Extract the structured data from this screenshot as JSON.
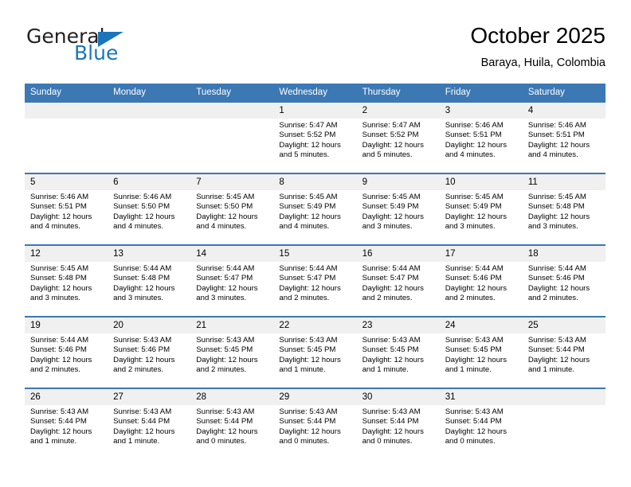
{
  "brand": {
    "name_top": "General",
    "name_bottom": "Blue",
    "accent_color": "#1b75bb",
    "text_color": "#231f20"
  },
  "header": {
    "title": "October 2025",
    "subtitle": "Baraya, Huila, Colombia"
  },
  "theme": {
    "header_row_bg": "#3b78b4",
    "header_row_text": "#ffffff",
    "daynum_bg": "#f0f0f0",
    "cell_bg": "#ffffff",
    "row_divider": "#3b78b4"
  },
  "calendar": {
    "weekday_headers": [
      "Sunday",
      "Monday",
      "Tuesday",
      "Wednesday",
      "Thursday",
      "Friday",
      "Saturday"
    ],
    "weeks": [
      [
        {
          "day": "",
          "empty": true
        },
        {
          "day": "",
          "empty": true
        },
        {
          "day": "",
          "empty": true
        },
        {
          "day": "1",
          "sunrise": "Sunrise: 5:47 AM",
          "sunset": "Sunset: 5:52 PM",
          "daylight": "Daylight: 12 hours and 5 minutes."
        },
        {
          "day": "2",
          "sunrise": "Sunrise: 5:47 AM",
          "sunset": "Sunset: 5:52 PM",
          "daylight": "Daylight: 12 hours and 5 minutes."
        },
        {
          "day": "3",
          "sunrise": "Sunrise: 5:46 AM",
          "sunset": "Sunset: 5:51 PM",
          "daylight": "Daylight: 12 hours and 4 minutes."
        },
        {
          "day": "4",
          "sunrise": "Sunrise: 5:46 AM",
          "sunset": "Sunset: 5:51 PM",
          "daylight": "Daylight: 12 hours and 4 minutes."
        }
      ],
      [
        {
          "day": "5",
          "sunrise": "Sunrise: 5:46 AM",
          "sunset": "Sunset: 5:51 PM",
          "daylight": "Daylight: 12 hours and 4 minutes."
        },
        {
          "day": "6",
          "sunrise": "Sunrise: 5:46 AM",
          "sunset": "Sunset: 5:50 PM",
          "daylight": "Daylight: 12 hours and 4 minutes."
        },
        {
          "day": "7",
          "sunrise": "Sunrise: 5:45 AM",
          "sunset": "Sunset: 5:50 PM",
          "daylight": "Daylight: 12 hours and 4 minutes."
        },
        {
          "day": "8",
          "sunrise": "Sunrise: 5:45 AM",
          "sunset": "Sunset: 5:49 PM",
          "daylight": "Daylight: 12 hours and 4 minutes."
        },
        {
          "day": "9",
          "sunrise": "Sunrise: 5:45 AM",
          "sunset": "Sunset: 5:49 PM",
          "daylight": "Daylight: 12 hours and 3 minutes."
        },
        {
          "day": "10",
          "sunrise": "Sunrise: 5:45 AM",
          "sunset": "Sunset: 5:49 PM",
          "daylight": "Daylight: 12 hours and 3 minutes."
        },
        {
          "day": "11",
          "sunrise": "Sunrise: 5:45 AM",
          "sunset": "Sunset: 5:48 PM",
          "daylight": "Daylight: 12 hours and 3 minutes."
        }
      ],
      [
        {
          "day": "12",
          "sunrise": "Sunrise: 5:45 AM",
          "sunset": "Sunset: 5:48 PM",
          "daylight": "Daylight: 12 hours and 3 minutes."
        },
        {
          "day": "13",
          "sunrise": "Sunrise: 5:44 AM",
          "sunset": "Sunset: 5:48 PM",
          "daylight": "Daylight: 12 hours and 3 minutes."
        },
        {
          "day": "14",
          "sunrise": "Sunrise: 5:44 AM",
          "sunset": "Sunset: 5:47 PM",
          "daylight": "Daylight: 12 hours and 3 minutes."
        },
        {
          "day": "15",
          "sunrise": "Sunrise: 5:44 AM",
          "sunset": "Sunset: 5:47 PM",
          "daylight": "Daylight: 12 hours and 2 minutes."
        },
        {
          "day": "16",
          "sunrise": "Sunrise: 5:44 AM",
          "sunset": "Sunset: 5:47 PM",
          "daylight": "Daylight: 12 hours and 2 minutes."
        },
        {
          "day": "17",
          "sunrise": "Sunrise: 5:44 AM",
          "sunset": "Sunset: 5:46 PM",
          "daylight": "Daylight: 12 hours and 2 minutes."
        },
        {
          "day": "18",
          "sunrise": "Sunrise: 5:44 AM",
          "sunset": "Sunset: 5:46 PM",
          "daylight": "Daylight: 12 hours and 2 minutes."
        }
      ],
      [
        {
          "day": "19",
          "sunrise": "Sunrise: 5:44 AM",
          "sunset": "Sunset: 5:46 PM",
          "daylight": "Daylight: 12 hours and 2 minutes."
        },
        {
          "day": "20",
          "sunrise": "Sunrise: 5:43 AM",
          "sunset": "Sunset: 5:46 PM",
          "daylight": "Daylight: 12 hours and 2 minutes."
        },
        {
          "day": "21",
          "sunrise": "Sunrise: 5:43 AM",
          "sunset": "Sunset: 5:45 PM",
          "daylight": "Daylight: 12 hours and 2 minutes."
        },
        {
          "day": "22",
          "sunrise": "Sunrise: 5:43 AM",
          "sunset": "Sunset: 5:45 PM",
          "daylight": "Daylight: 12 hours and 1 minute."
        },
        {
          "day": "23",
          "sunrise": "Sunrise: 5:43 AM",
          "sunset": "Sunset: 5:45 PM",
          "daylight": "Daylight: 12 hours and 1 minute."
        },
        {
          "day": "24",
          "sunrise": "Sunrise: 5:43 AM",
          "sunset": "Sunset: 5:45 PM",
          "daylight": "Daylight: 12 hours and 1 minute."
        },
        {
          "day": "25",
          "sunrise": "Sunrise: 5:43 AM",
          "sunset": "Sunset: 5:44 PM",
          "daylight": "Daylight: 12 hours and 1 minute."
        }
      ],
      [
        {
          "day": "26",
          "sunrise": "Sunrise: 5:43 AM",
          "sunset": "Sunset: 5:44 PM",
          "daylight": "Daylight: 12 hours and 1 minute."
        },
        {
          "day": "27",
          "sunrise": "Sunrise: 5:43 AM",
          "sunset": "Sunset: 5:44 PM",
          "daylight": "Daylight: 12 hours and 1 minute."
        },
        {
          "day": "28",
          "sunrise": "Sunrise: 5:43 AM",
          "sunset": "Sunset: 5:44 PM",
          "daylight": "Daylight: 12 hours and 0 minutes."
        },
        {
          "day": "29",
          "sunrise": "Sunrise: 5:43 AM",
          "sunset": "Sunset: 5:44 PM",
          "daylight": "Daylight: 12 hours and 0 minutes."
        },
        {
          "day": "30",
          "sunrise": "Sunrise: 5:43 AM",
          "sunset": "Sunset: 5:44 PM",
          "daylight": "Daylight: 12 hours and 0 minutes."
        },
        {
          "day": "31",
          "sunrise": "Sunrise: 5:43 AM",
          "sunset": "Sunset: 5:44 PM",
          "daylight": "Daylight: 12 hours and 0 minutes."
        },
        {
          "day": "",
          "empty": true
        }
      ]
    ]
  }
}
